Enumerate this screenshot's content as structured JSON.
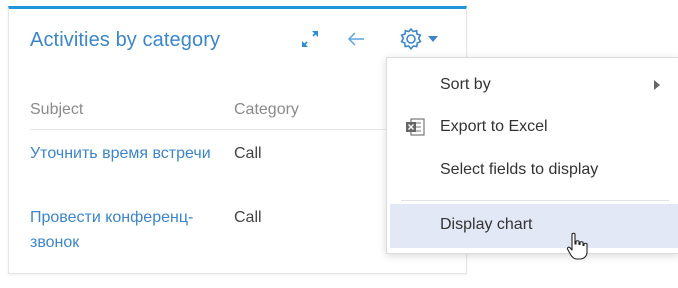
{
  "widget": {
    "title": "Activities by category",
    "accent_color": "#2196d9",
    "title_color": "#3b86c9",
    "columns": {
      "subject": "Subject",
      "category": "Category"
    },
    "rows": [
      {
        "subject": "Уточнить время встречи",
        "category": "Call"
      },
      {
        "subject": "Провести конференц-звонок",
        "category": "Call"
      }
    ],
    "icons": {
      "expand": "expand-icon",
      "back": "arrow-left-icon",
      "settings": "gear-icon",
      "dropdown": "caret-down-icon"
    }
  },
  "menu": {
    "items": [
      {
        "label": "Sort by",
        "icon": "chevron-right-icon"
      },
      {
        "label": "Export to Excel",
        "icon": "excel-icon"
      },
      {
        "label": "Select fields to display"
      },
      {
        "label": "Display chart",
        "state": "hovered"
      }
    ],
    "hover_color": "#e3e8f6"
  },
  "cursor": {
    "icon": "hand-pointer-icon"
  }
}
